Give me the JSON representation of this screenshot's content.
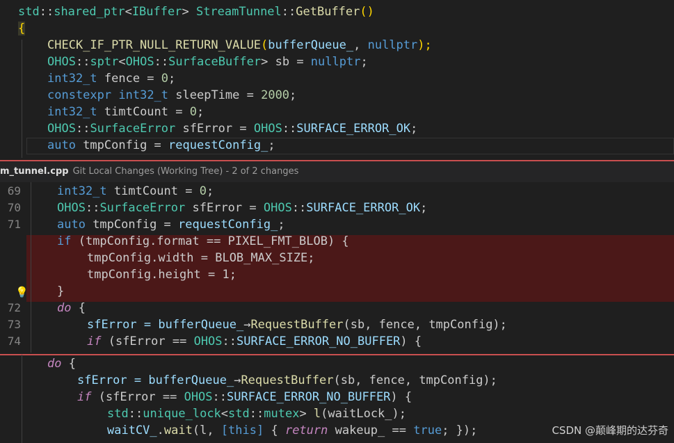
{
  "top": {
    "line1": [
      "std",
      "::",
      "shared_ptr",
      "<",
      "IBuffer",
      "> ",
      "StreamTunnel",
      "::",
      "GetBuffer",
      "()"
    ],
    "line2": "{",
    "line3": [
      "CHECK_IF_PTR_NULL_RETURN_VALUE",
      "(",
      "bufferQueue_",
      ", ",
      "nullptr",
      ");"
    ],
    "line4": [
      "OHOS",
      "::",
      "sptr",
      "<",
      "OHOS",
      "::",
      "SurfaceBuffer",
      "> sb = ",
      "nullptr",
      ";"
    ],
    "line5": [
      "int32_t",
      " fence = ",
      "0",
      ";"
    ],
    "line6": [
      "constexpr",
      " ",
      "int32_t",
      " sleepTime = ",
      "2000",
      ";"
    ],
    "line7": [
      "int32_t",
      " timtCount = ",
      "0",
      ";"
    ],
    "line8": [
      "OHOS",
      "::",
      "SurfaceError",
      " sfError = ",
      "OHOS",
      "::",
      "SURFACE_ERROR_OK",
      ";"
    ],
    "line9": [
      "auto",
      " tmpConfig = ",
      "requestConfig_",
      ";"
    ]
  },
  "peek": {
    "file": "m_tunnel.cpp",
    "desc": "Git Local Changes (Working Tree) - 2 of 2 changes",
    "ln69": "69",
    "ln70": "70",
    "ln71": "71",
    "ln72": "72",
    "ln73": "73",
    "ln74": "74",
    "l69": [
      "int32_t",
      " timtCount = ",
      "0",
      ";"
    ],
    "l70": [
      "OHOS",
      "::",
      "SurfaceError",
      " sfError = ",
      "OHOS",
      "::",
      "SURFACE_ERROR_OK",
      ";"
    ],
    "l71": [
      "auto",
      " tmpConfig = ",
      "requestConfig_",
      ";"
    ],
    "d1": [
      "if",
      " (tmpConfig.format ",
      "==",
      " PIXEL_FMT_BLOB) {"
    ],
    "d2": "tmpConfig.width = BLOB_MAX_SIZE;",
    "d3": "tmpConfig.height = 1;",
    "d4": "}",
    "l72": [
      "do",
      " {"
    ],
    "l73": [
      "sfError = ",
      "bufferQueue_",
      "→",
      "RequestBuffer",
      "(sb, fence, tmpConfig);"
    ],
    "l74": [
      "if",
      " (sfError ",
      "==",
      " ",
      "OHOS",
      "::",
      "SURFACE_ERROR_NO_BUFFER",
      ") {"
    ]
  },
  "bottom": {
    "b1": [
      "do",
      " {"
    ],
    "b2": [
      "sfError = ",
      "bufferQueue_",
      "→",
      "RequestBuffer",
      "(sb, fence, tmpConfig);"
    ],
    "b3": [
      "if",
      " (sfError ",
      "==",
      " ",
      "OHOS",
      "::",
      "SURFACE_ERROR_NO_BUFFER",
      ") {"
    ],
    "b4": [
      "std",
      "::",
      "unique_lock",
      "<",
      "std",
      "::",
      "mutex",
      "> ",
      "l",
      "(waitLock_);"
    ],
    "b5": [
      "waitCV_",
      ".",
      "wait",
      "(l, ",
      "[this]",
      " { ",
      "return",
      " wakeup_ ",
      "==",
      " ",
      "true",
      "; });"
    ]
  },
  "watermark": "CSDN @颠峰期的达芬奇"
}
